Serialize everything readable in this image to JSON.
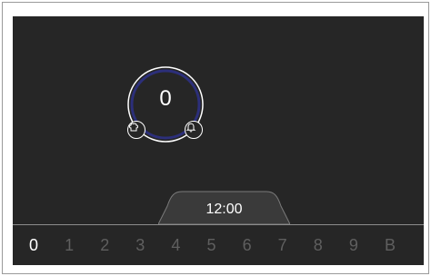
{
  "dial": {
    "value": "0"
  },
  "clock": {
    "time": "12:00"
  },
  "selector": {
    "items": [
      "0",
      "1",
      "2",
      "3",
      "4",
      "5",
      "6",
      "7",
      "8",
      "9",
      "B"
    ],
    "active": "0"
  },
  "icons": {
    "left_badge": "chef-hat-icon",
    "right_badge": "bell-icon"
  },
  "colors": {
    "screen": "#262626",
    "ring_outer": "#ffffff",
    "ring_inner": "#2c2f7a",
    "inactive_text": "#5f5f5f",
    "active_text": "#ffffff"
  }
}
